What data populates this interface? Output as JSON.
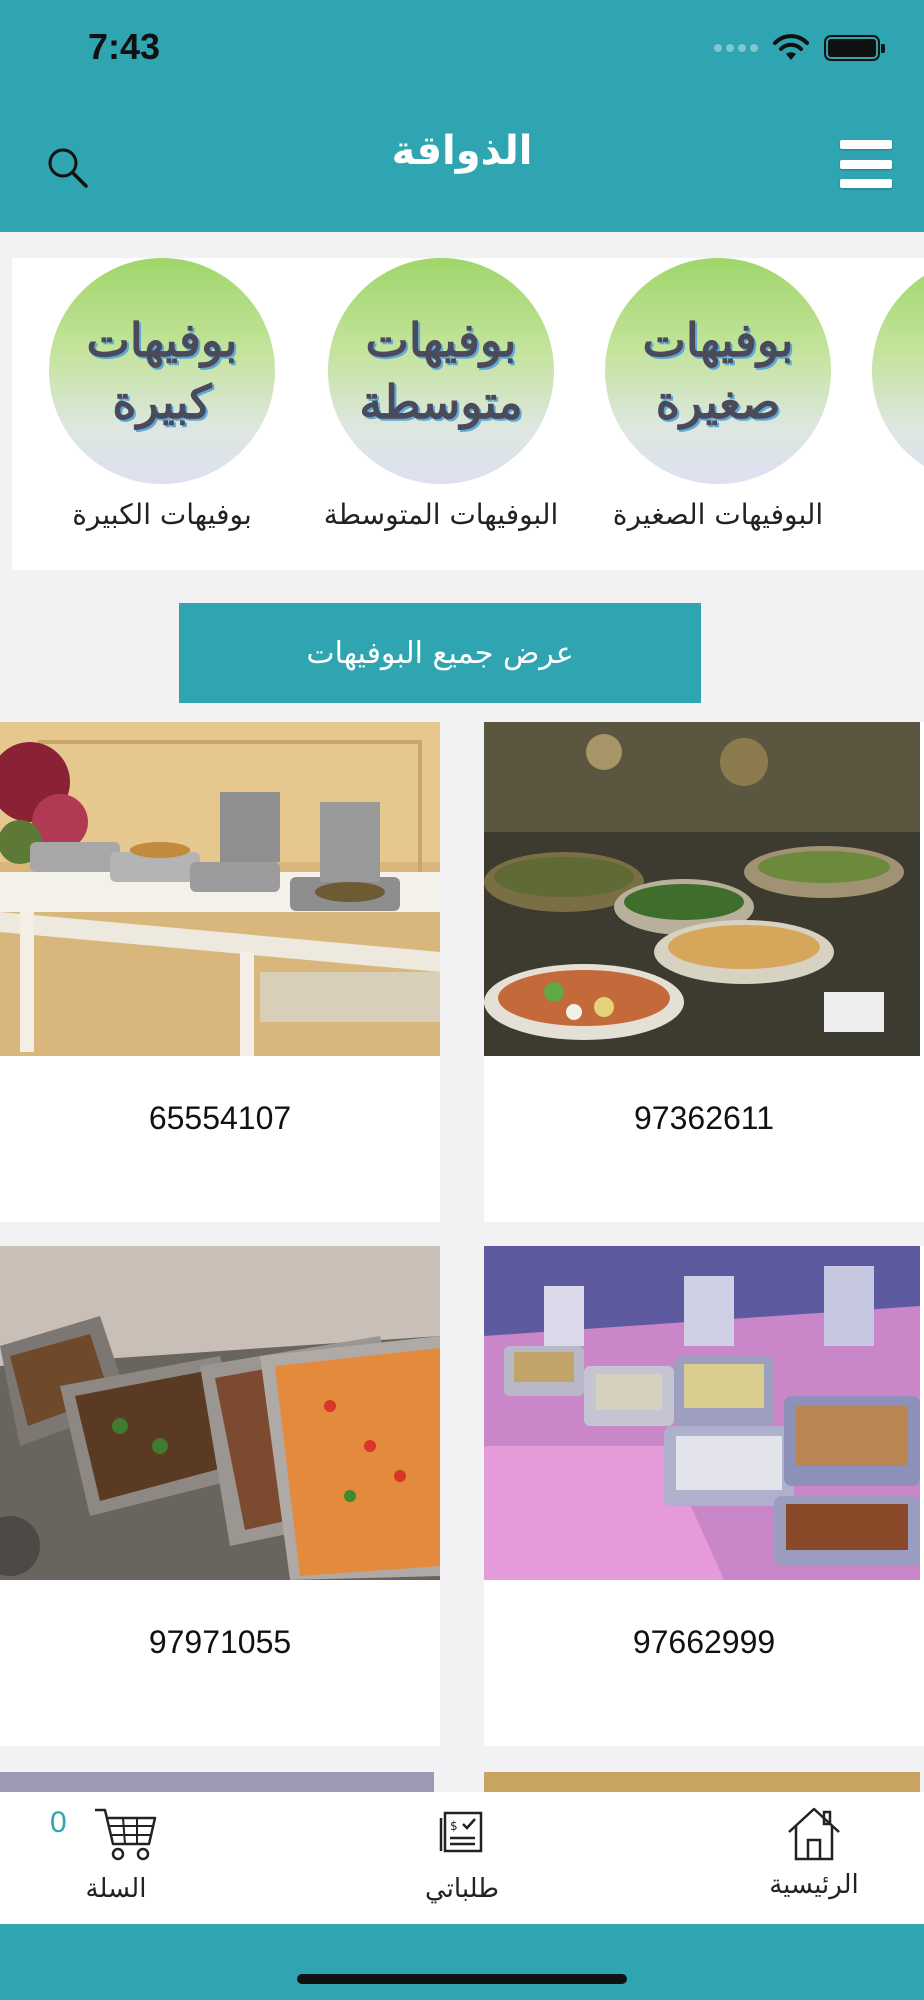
{
  "status_bar": {
    "time": "7:43"
  },
  "header": {
    "title": "الذواقة",
    "search_icon": "search-icon",
    "menu_icon": "hamburger-menu-icon"
  },
  "categories": [
    {
      "circle_line1": "بوفيهات",
      "circle_line2": "كبيرة",
      "label": "بوفيهات الكبيرة"
    },
    {
      "circle_line1": "بوفيهات",
      "circle_line2": "متوسطة",
      "label": "البوفيهات المتوسطة"
    },
    {
      "circle_line1": "بوفيهات",
      "circle_line2": "صغيرة",
      "label": "البوفيهات الصغيرة"
    }
  ],
  "show_all_label": "عرض جميع البوفيهات",
  "products": [
    {
      "phone": "65554107"
    },
    {
      "phone": "97362611"
    },
    {
      "phone": "97971055"
    },
    {
      "phone": "97662999"
    }
  ],
  "bottom_nav": {
    "cart_label": "السلة",
    "cart_count": "0",
    "orders_label": "طلباتي",
    "home_label": "الرئيسية"
  },
  "colors": {
    "primary": "#30a5b2",
    "background": "#f2f2f4"
  }
}
